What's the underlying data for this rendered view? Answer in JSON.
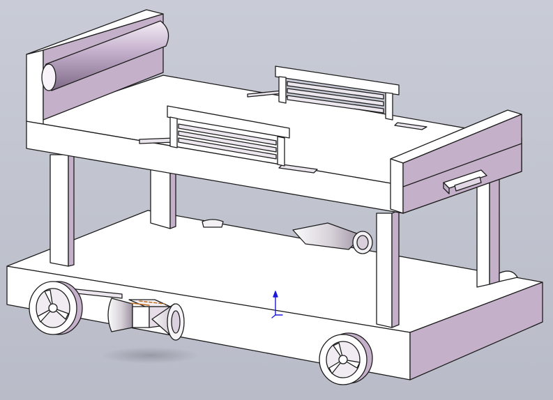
{
  "viewport": {
    "background_top": "#c9ccd6",
    "background_bottom": "#b9bcc8"
  },
  "model": {
    "face_light": "#ffffff",
    "face_shade": "#c4b0c8",
    "face_shade_dark": "#a890ab",
    "edge_color": "#1c1c1c",
    "wheel_spokes": 3,
    "origin_triad_color": "#1a1ad8"
  }
}
